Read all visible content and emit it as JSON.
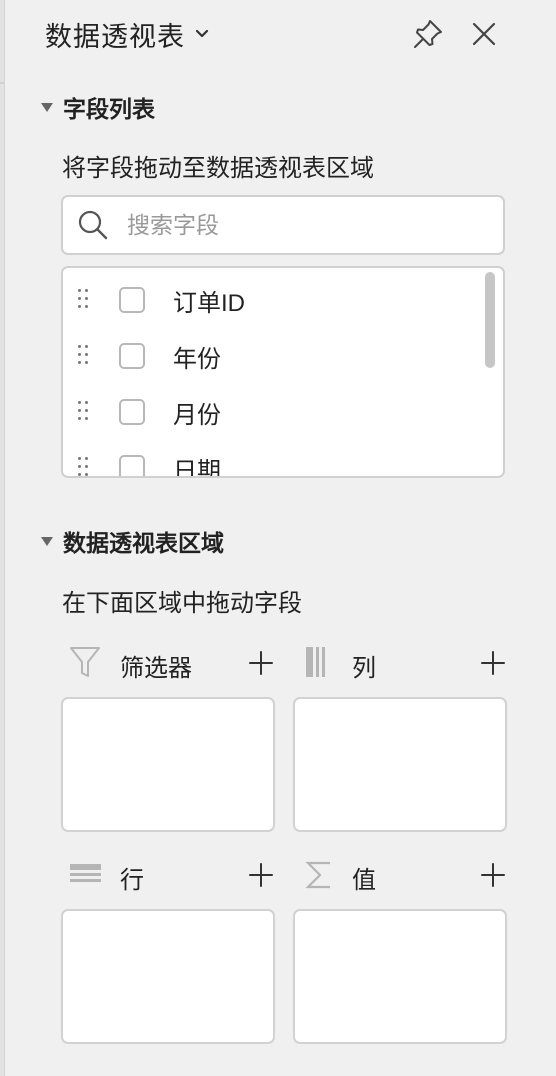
{
  "panel": {
    "title": "数据透视表",
    "pin_icon": "pin-icon",
    "close_icon": "close-icon"
  },
  "field_list_section": {
    "title": "字段列表",
    "description": "将字段拖动至数据透视表区域",
    "search": {
      "placeholder": "搜索字段",
      "value": ""
    },
    "fields": [
      {
        "label": "订单ID",
        "checked": false
      },
      {
        "label": "年份",
        "checked": false
      },
      {
        "label": "月份",
        "checked": false
      },
      {
        "label": "日期",
        "checked": false
      }
    ]
  },
  "areas_section": {
    "title": "数据透视表区域",
    "description": "在下面区域中拖动字段",
    "areas": {
      "filters": {
        "label": "筛选器",
        "icon": "filter-icon"
      },
      "columns": {
        "label": "列",
        "icon": "columns-icon"
      },
      "rows": {
        "label": "行",
        "icon": "rows-icon"
      },
      "values": {
        "label": "值",
        "icon": "sigma-icon"
      }
    }
  },
  "colors": {
    "panel_bg": "#f0f0f0",
    "box_bg": "#ffffff",
    "border": "#d0d0d0",
    "icon": "#555555",
    "icon_muted": "#b5b5b5"
  }
}
